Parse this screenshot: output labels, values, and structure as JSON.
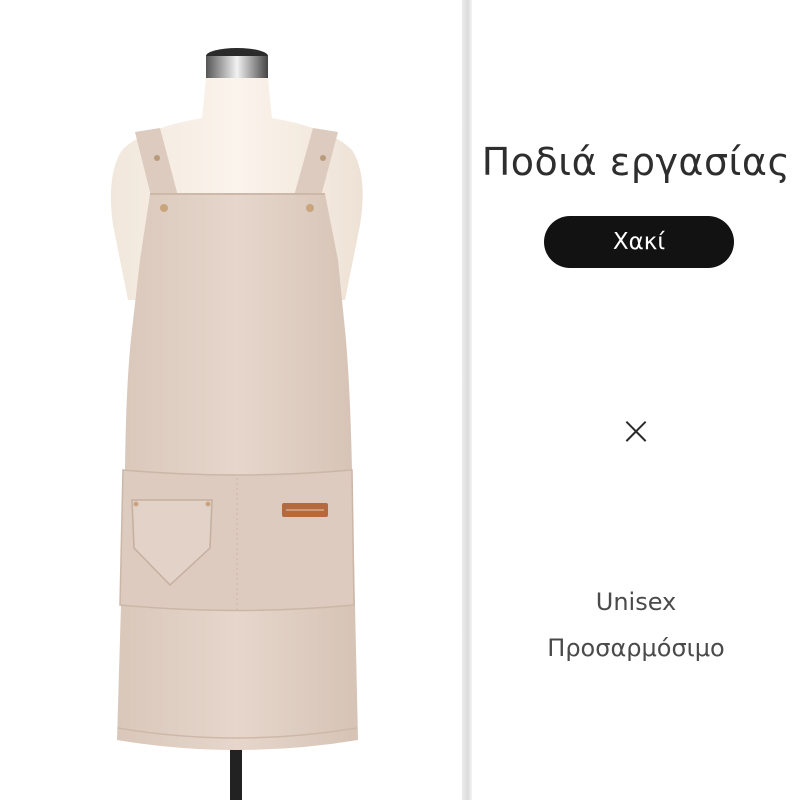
{
  "product": {
    "title": "Ποδιά εργασίας",
    "color_label": "Χακί",
    "separator": "×",
    "features": [
      "Unisex",
      "Προσαρμόσιμο"
    ]
  },
  "image": {
    "description_icon": "apron-on-mannequin",
    "apron_color": "#e0cfc3",
    "label_color": "#b56a3e"
  }
}
